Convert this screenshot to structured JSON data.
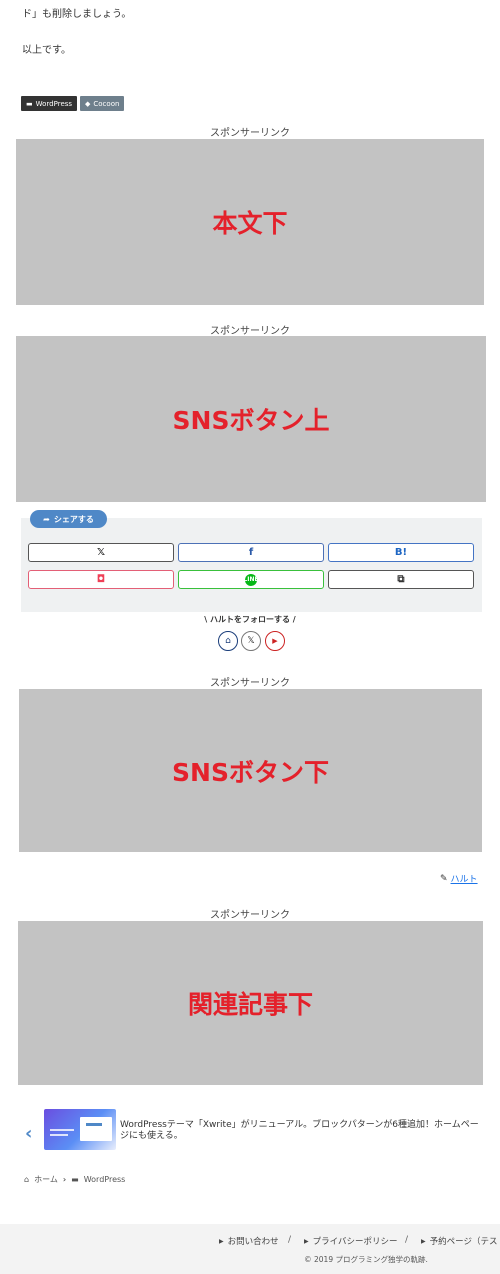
{
  "article": {
    "text_line_end": "ド」も削除しましょう。",
    "text_closing": "以上です。"
  },
  "tags": [
    {
      "label": "WordPress",
      "icon": "folder-icon"
    },
    {
      "label": "Cocoon",
      "icon": "tag-icon"
    }
  ],
  "sponsor_label": "スポンサーリンク",
  "ads": [
    {
      "label": "本文下"
    },
    {
      "label": "SNSボタン上"
    },
    {
      "label": "SNSボタン下"
    },
    {
      "label": "関連記事下"
    }
  ],
  "share": {
    "pill_label": "シェアする",
    "buttons": [
      {
        "glyph": "𝕏",
        "icon": "x-icon"
      },
      {
        "glyph": "f",
        "icon": "facebook-icon"
      },
      {
        "glyph": "B!",
        "icon": "hatena-bookmark-icon"
      },
      {
        "glyph": "◘",
        "icon": "pocket-icon"
      },
      {
        "glyph": "LINE",
        "icon": "line-icon"
      },
      {
        "glyph": "⧉",
        "icon": "copy-icon"
      }
    ]
  },
  "follow": {
    "label": "\\ ハルトをフォローする /",
    "buttons": [
      {
        "glyph": "⌂",
        "icon": "home-icon",
        "color": "#1a3d7a"
      },
      {
        "glyph": "𝕏",
        "icon": "x-icon",
        "color": "#222222"
      },
      {
        "glyph": "▶",
        "icon": "youtube-icon",
        "color": "#cc2222"
      }
    ]
  },
  "author": {
    "name": "ハルト"
  },
  "prev_post": {
    "title": "WordPressテーマ「Xwrite」がリニューアル。ブロックパターンが6種追加！ホームページにも使える。"
  },
  "breadcrumb": {
    "home": "ホーム",
    "category": "WordPress"
  },
  "footer": {
    "links": [
      "お問い合わせ",
      "プライバシーポリシー",
      "予約ページ（テスト"
    ],
    "separator": "/",
    "copyright": "© 2019 プログラミング独学の軌跡."
  },
  "colors": {
    "ad_text": "#e4212b",
    "ad_bg": "#c3c3c3",
    "accent": "#4f88c7"
  }
}
